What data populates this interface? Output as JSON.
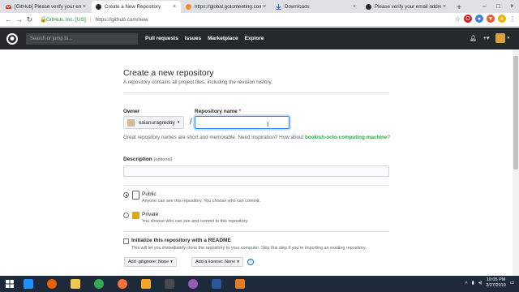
{
  "tabs": [
    {
      "title": "[GitHub] Please verify your em...",
      "favicon": "mail-icon",
      "color": "#d44638"
    },
    {
      "title": "Create a New Repository",
      "favicon": "github-icon",
      "color": "#24292e",
      "active": true
    },
    {
      "title": "https://global.gotomeeting.com...",
      "favicon": "gotomeeting-icon",
      "color": "#f68d2e"
    },
    {
      "title": "Downloads",
      "favicon": "download-icon",
      "color": "#1a73e8"
    },
    {
      "title": "Please verify your email address",
      "favicon": "github-icon",
      "color": "#24292e"
    }
  ],
  "addressbar": {
    "org": "GitHub, Inc. [US]",
    "url": "https://github.com/new"
  },
  "ghheader": {
    "search_placeholder": "Search or jump to...",
    "nav": [
      "Pull requests",
      "Issues",
      "Marketplace",
      "Explore"
    ]
  },
  "page": {
    "title": "Create a new repository",
    "subtitle": "A repository contains all project files, including the revision history.",
    "owner_label": "Owner",
    "owner_value": "saianuragreddy",
    "repo_label": "Repository name",
    "required_mark": "*",
    "slash": "/",
    "hint_prefix": "Great repository names are short and memorable. Need inspiration? How about",
    "hint_suggestion": "bookish-octo-computing-machine",
    "hint_suffix": "?",
    "description_label": "Description",
    "description_optional": "(optional)",
    "public_label": "Public",
    "public_desc": "Anyone can see this repository. You choose who can commit.",
    "private_label": "Private",
    "private_desc": "You choose who can see and commit to this repository.",
    "readme_label": "Initialize this repository with a README",
    "readme_desc": "This will let you immediately clone the repository to your computer. Skip this step if you’re importing an existing repository.",
    "gitignore_label": "Add .gitignore: None",
    "license_label": "Add a license: None",
    "visibility": "public"
  },
  "taskbar": {
    "apps": [
      {
        "name": "ie-icon",
        "color": "#1e90ff"
      },
      {
        "name": "firefox-icon",
        "color": "#e66000"
      },
      {
        "name": "file-explorer-icon",
        "color": "#f2c94c"
      },
      {
        "name": "chrome-icon",
        "color": "#34a853"
      },
      {
        "name": "firefox-dev-icon",
        "color": "#ff7139"
      },
      {
        "name": "app-orange-icon",
        "color": "#f5a623"
      },
      {
        "name": "screen-capture-icon",
        "color": "#4a4a4a"
      },
      {
        "name": "paint-icon",
        "color": "#9b59b6"
      },
      {
        "name": "word-icon",
        "color": "#2b579a"
      },
      {
        "name": "photos-icon",
        "color": "#e67e22"
      }
    ],
    "time": "10:05 PM",
    "date": "2/27/2019"
  }
}
